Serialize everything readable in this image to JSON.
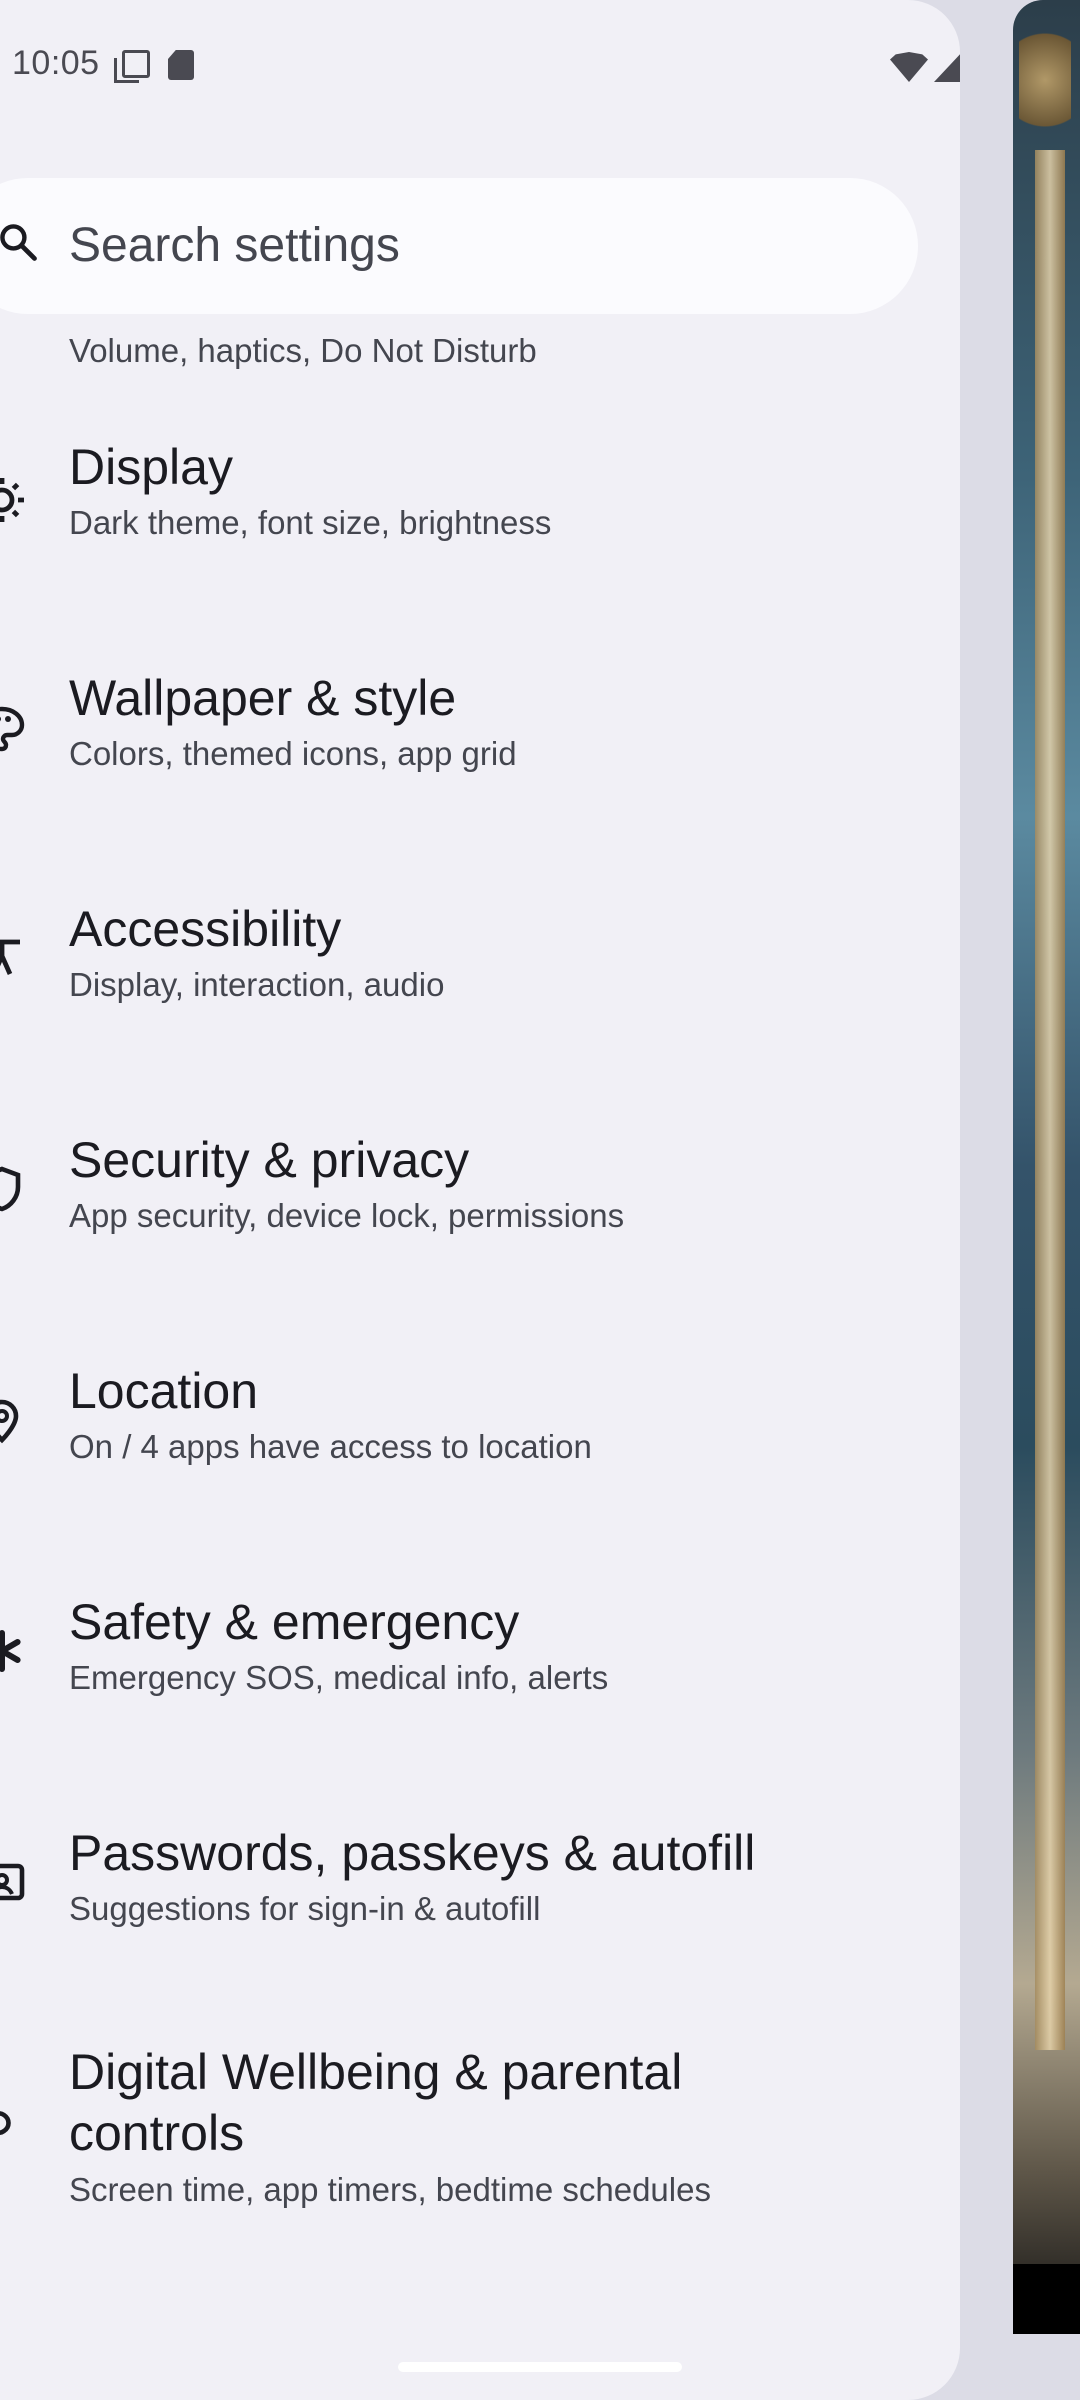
{
  "status_bar": {
    "time": "10:05",
    "left_icons": [
      "copy-icon",
      "sd-card-icon"
    ],
    "right_icons": [
      "wifi-icon",
      "signal-icon",
      "battery-icon"
    ]
  },
  "search": {
    "placeholder": "Search settings"
  },
  "partial_item": {
    "subtitle": "Volume, haptics, Do Not Disturb"
  },
  "items": [
    {
      "title": "Display",
      "subtitle": "Dark theme, font size, brightness",
      "icon": "brightness-icon"
    },
    {
      "title": "Wallpaper & style",
      "subtitle": "Colors, themed icons, app grid",
      "icon": "palette-icon"
    },
    {
      "title": "Accessibility",
      "subtitle": "Display, interaction, audio",
      "icon": "accessibility-icon"
    },
    {
      "title": "Security & privacy",
      "subtitle": "App security, device lock, permissions",
      "icon": "shield-icon"
    },
    {
      "title": "Location",
      "subtitle": "On / 4 apps have access to location",
      "icon": "location-pin-icon"
    },
    {
      "title": "Safety & emergency",
      "subtitle": "Emergency SOS, medical info, alerts",
      "icon": "emergency-asterisk-icon"
    },
    {
      "title": "Passwords, passkeys & autofill",
      "subtitle": "Suggestions for sign-in & autofill",
      "icon": "id-card-icon"
    },
    {
      "title_line1": "Digital Wellbeing & parental",
      "title_line2": "controls",
      "subtitle": "Screen time, app timers, bedtime schedules",
      "icon": "wellbeing-icon"
    }
  ],
  "colors": {
    "panel_background": "#f1f0f6",
    "search_background": "#fbfbfe",
    "title_text": "#1b1b21",
    "subtitle_text": "#44464f"
  }
}
